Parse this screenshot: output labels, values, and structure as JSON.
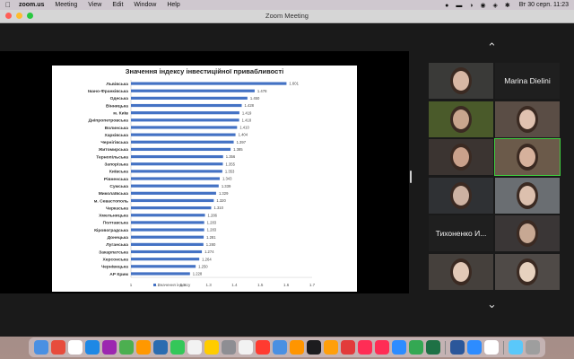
{
  "menubar": {
    "app": "zoom.us",
    "items": [
      "Meeting",
      "View",
      "Edit",
      "Window",
      "Help"
    ],
    "clock": "Вт 30 серп.  11:23"
  },
  "window": {
    "title": "Zoom Meeting"
  },
  "chart_data": {
    "type": "bar",
    "orientation": "horizontal",
    "title": "Значення індексу інвестиційної привабливості",
    "categories": [
      "Львівська",
      "Івано-Франківська",
      "Одеська",
      "Вінницька",
      "м. Київ",
      "Дніпропетровська",
      "Волинська",
      "Харківська",
      "Чернігівська",
      "Житомирська",
      "Тернопільська",
      "Запорізька",
      "Київська",
      "Рівненська",
      "Сумська",
      "Миколаївська",
      "м. Севастополь",
      "Черкаська",
      "Хмельницька",
      "Полтавська",
      "Кіровоградська",
      "Донецька",
      "Луганська",
      "Закарпатська",
      "Херсонська",
      "Чернівецька",
      "АР Крим"
    ],
    "values": [
      "1.601",
      "1.478",
      "1.450",
      "1.428",
      "1.419",
      "1.418",
      "1.410",
      "1.404",
      "1.397",
      "1.385",
      "1.356",
      "1.355",
      "1.353",
      "1.343",
      "1.339",
      "1.329",
      "1.320",
      "1.310",
      "1.286",
      "1.283",
      "1.283",
      "1.281",
      "1.280",
      "1.274",
      "1.264",
      "1.250",
      "1.228"
    ],
    "x_ticks": [
      "1",
      "1.1",
      "1.2",
      "1.3",
      "1.4",
      "1.5",
      "1.6",
      "1.7"
    ],
    "xlim": [
      1,
      1.7
    ],
    "legend": "Значення індексу",
    "bar_color": "#4472c4"
  },
  "participants": [
    {
      "type": "video"
    },
    {
      "type": "name",
      "name": "Marina Dielini"
    },
    {
      "type": "video"
    },
    {
      "type": "video"
    },
    {
      "type": "video"
    },
    {
      "type": "video",
      "active": true
    },
    {
      "type": "video"
    },
    {
      "type": "video"
    },
    {
      "type": "name",
      "name": "Тихоненко И..."
    },
    {
      "type": "video"
    },
    {
      "type": "video"
    },
    {
      "type": "video"
    }
  ],
  "icons": {
    "gallery_up": "chevron-up-icon",
    "gallery_down": "chevron-down-icon"
  }
}
